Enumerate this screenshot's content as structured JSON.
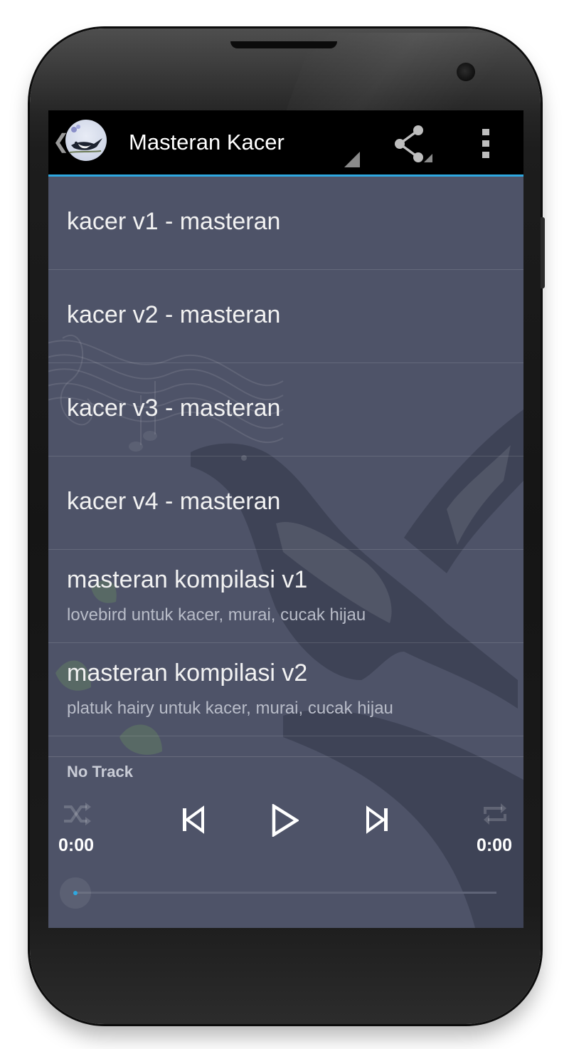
{
  "action_bar": {
    "title": "Masteran Kacer",
    "back_icon": "chevron-left-icon",
    "app_icon": "magpie-robin-bird-icon",
    "share_icon": "share-icon",
    "overflow_icon": "overflow-menu-icon",
    "accent_color": "#2ea8e0"
  },
  "tracks": [
    {
      "title": "kacer v1 - masteran"
    },
    {
      "title": "kacer v2 - masteran"
    },
    {
      "title": "kacer v3 - masteran"
    },
    {
      "title": "kacer v4 - masteran"
    },
    {
      "title": "masteran kompilasi v1",
      "subtitle": "lovebird untuk kacer, murai, cucak hijau"
    },
    {
      "title": "masteran kompilasi v2",
      "subtitle": "platuk hairy untuk kacer, murai, cucak hijau"
    }
  ],
  "player": {
    "now_playing": "No Track",
    "current_time": "0:00",
    "total_time": "0:00",
    "progress": 0,
    "controls": {
      "shuffle_icon": "shuffle-icon",
      "previous_icon": "skip-previous-icon",
      "play_icon": "play-icon",
      "next_icon": "skip-next-icon",
      "repeat_icon": "repeat-icon"
    }
  },
  "colors": {
    "list_background": "#4e5368",
    "action_bar_background": "#000000"
  }
}
